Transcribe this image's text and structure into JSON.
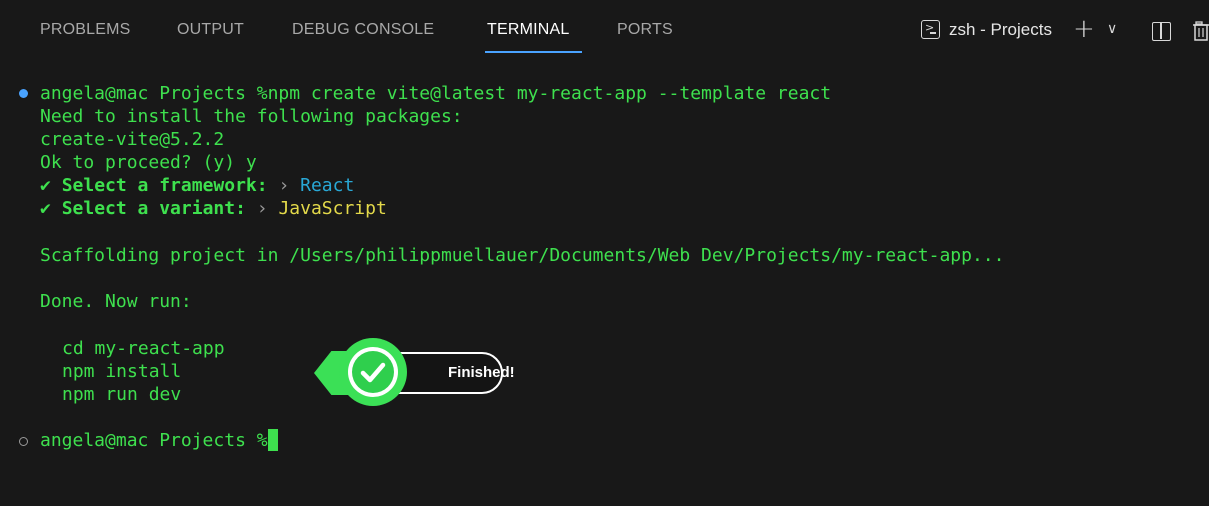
{
  "panel": {
    "tabs": [
      {
        "label": "PROBLEMS",
        "active": false
      },
      {
        "label": "OUTPUT",
        "active": false
      },
      {
        "label": "DEBUG CONSOLE",
        "active": false
      },
      {
        "label": "TERMINAL",
        "active": true
      },
      {
        "label": "PORTS",
        "active": false
      }
    ],
    "terminal_selector": {
      "icon": "terminal-icon",
      "label": "zsh - Projects"
    },
    "actions": {
      "new_terminal": {
        "icon": "plus-icon",
        "glyph": "+"
      },
      "dropdown": {
        "icon": "chevron-down-icon",
        "glyph": "∨"
      },
      "split": {
        "icon": "split-terminal-icon"
      },
      "kill": {
        "icon": "trash-icon"
      }
    }
  },
  "terminal": {
    "prompt1": "angela@mac Projects %",
    "command": "npm create vite@latest my-react-app --template react",
    "out_need": "Need to install the following packages:",
    "out_pkg": "create-vite@5.2.2",
    "out_ok": "Ok to proceed? (y) y",
    "check": "✔",
    "arrow": "›",
    "framework_label": "Select a framework:",
    "framework_value": "React",
    "variant_label": "Select a variant:",
    "variant_value": "JavaScript",
    "scaffold": "Scaffolding project in /Users/philippmuellauer/Documents/Web Dev/Projects/my-react-app...",
    "done": "Done. Now run:",
    "cmd_cd": "cd my-react-app",
    "cmd_install": "npm install",
    "cmd_dev": "npm run dev",
    "prompt2": "angela@mac Projects %"
  },
  "toast": {
    "label": "Finished!",
    "icon": "check-circle-icon"
  },
  "colors": {
    "background": "#181818",
    "terminal_green": "#3ee04e",
    "cyan": "#29a8d6",
    "yellow": "#e3d94a",
    "accent_blue": "#4aa3ff",
    "toast_green": "#3be056"
  }
}
